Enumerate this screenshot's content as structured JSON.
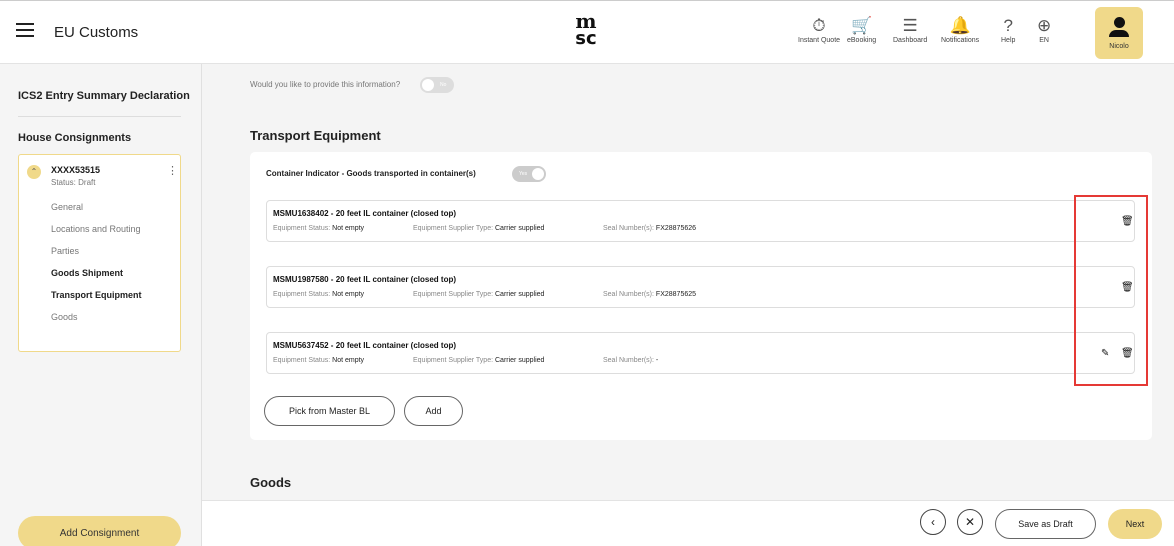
{
  "header": {
    "app_title": "EU Customs",
    "logo_top": "m",
    "logo_bottom": "sc",
    "nav": [
      {
        "label": "Instant Quote",
        "icon": "instant-quote-icon"
      },
      {
        "label": "eBooking",
        "icon": "cart-icon"
      },
      {
        "label": "Dashboard",
        "icon": "sliders-icon"
      },
      {
        "label": "Notifications",
        "icon": "bell-icon"
      },
      {
        "label": "Help",
        "icon": "help-icon"
      },
      {
        "label": "EN",
        "icon": "globe-icon"
      }
    ],
    "user_name": "Nicolo"
  },
  "sidebar": {
    "heading": "ICS2 Entry Summary Declaration",
    "house_consignments": "House Consignments",
    "consignment": {
      "id": "XXXX53515",
      "status": "Status: Draft",
      "nav": [
        "General",
        "Locations and Routing",
        "Parties",
        "Goods Shipment",
        "Transport Equipment",
        "Goods"
      ]
    },
    "add_consignment": "Add Consignment"
  },
  "main": {
    "question": "Would you like to provide this information?",
    "question_toggle": "No",
    "transport_title": "Transport Equipment",
    "container_indicator": "Container Indicator - Goods transported in container(s)",
    "container_toggle": "Yes",
    "equipment": [
      {
        "title": "MSMU1638402 - 20 feet IL container (closed top)",
        "status_label": "Equipment Status:",
        "status": "Not empty",
        "supplier_label": "Equipment Supplier Type:",
        "supplier": "Carrier supplied",
        "seal_label": "Seal Number(s):",
        "seal": "FX28875626"
      },
      {
        "title": "MSMU1987580 - 20 feet IL container (closed top)",
        "status_label": "Equipment Status:",
        "status": "Not empty",
        "supplier_label": "Equipment Supplier Type:",
        "supplier": "Carrier supplied",
        "seal_label": "Seal Number(s):",
        "seal": "FX28875625"
      },
      {
        "title": "MSMU5637452 - 20 feet IL container (closed top)",
        "status_label": "Equipment Status:",
        "status": "Not empty",
        "supplier_label": "Equipment Supplier Type:",
        "supplier": "Carrier supplied",
        "seal_label": "Seal Number(s):",
        "seal": "-"
      }
    ],
    "pick_from_master": "Pick from Master BL",
    "add": "Add",
    "goods_title": "Goods"
  },
  "footer": {
    "prev_icon": "chevron-left-icon",
    "close_icon": "close-icon",
    "save_draft": "Save as Draft",
    "next": "Next"
  },
  "colors": {
    "accent": "#f0d98a",
    "highlight": "#e53935"
  }
}
